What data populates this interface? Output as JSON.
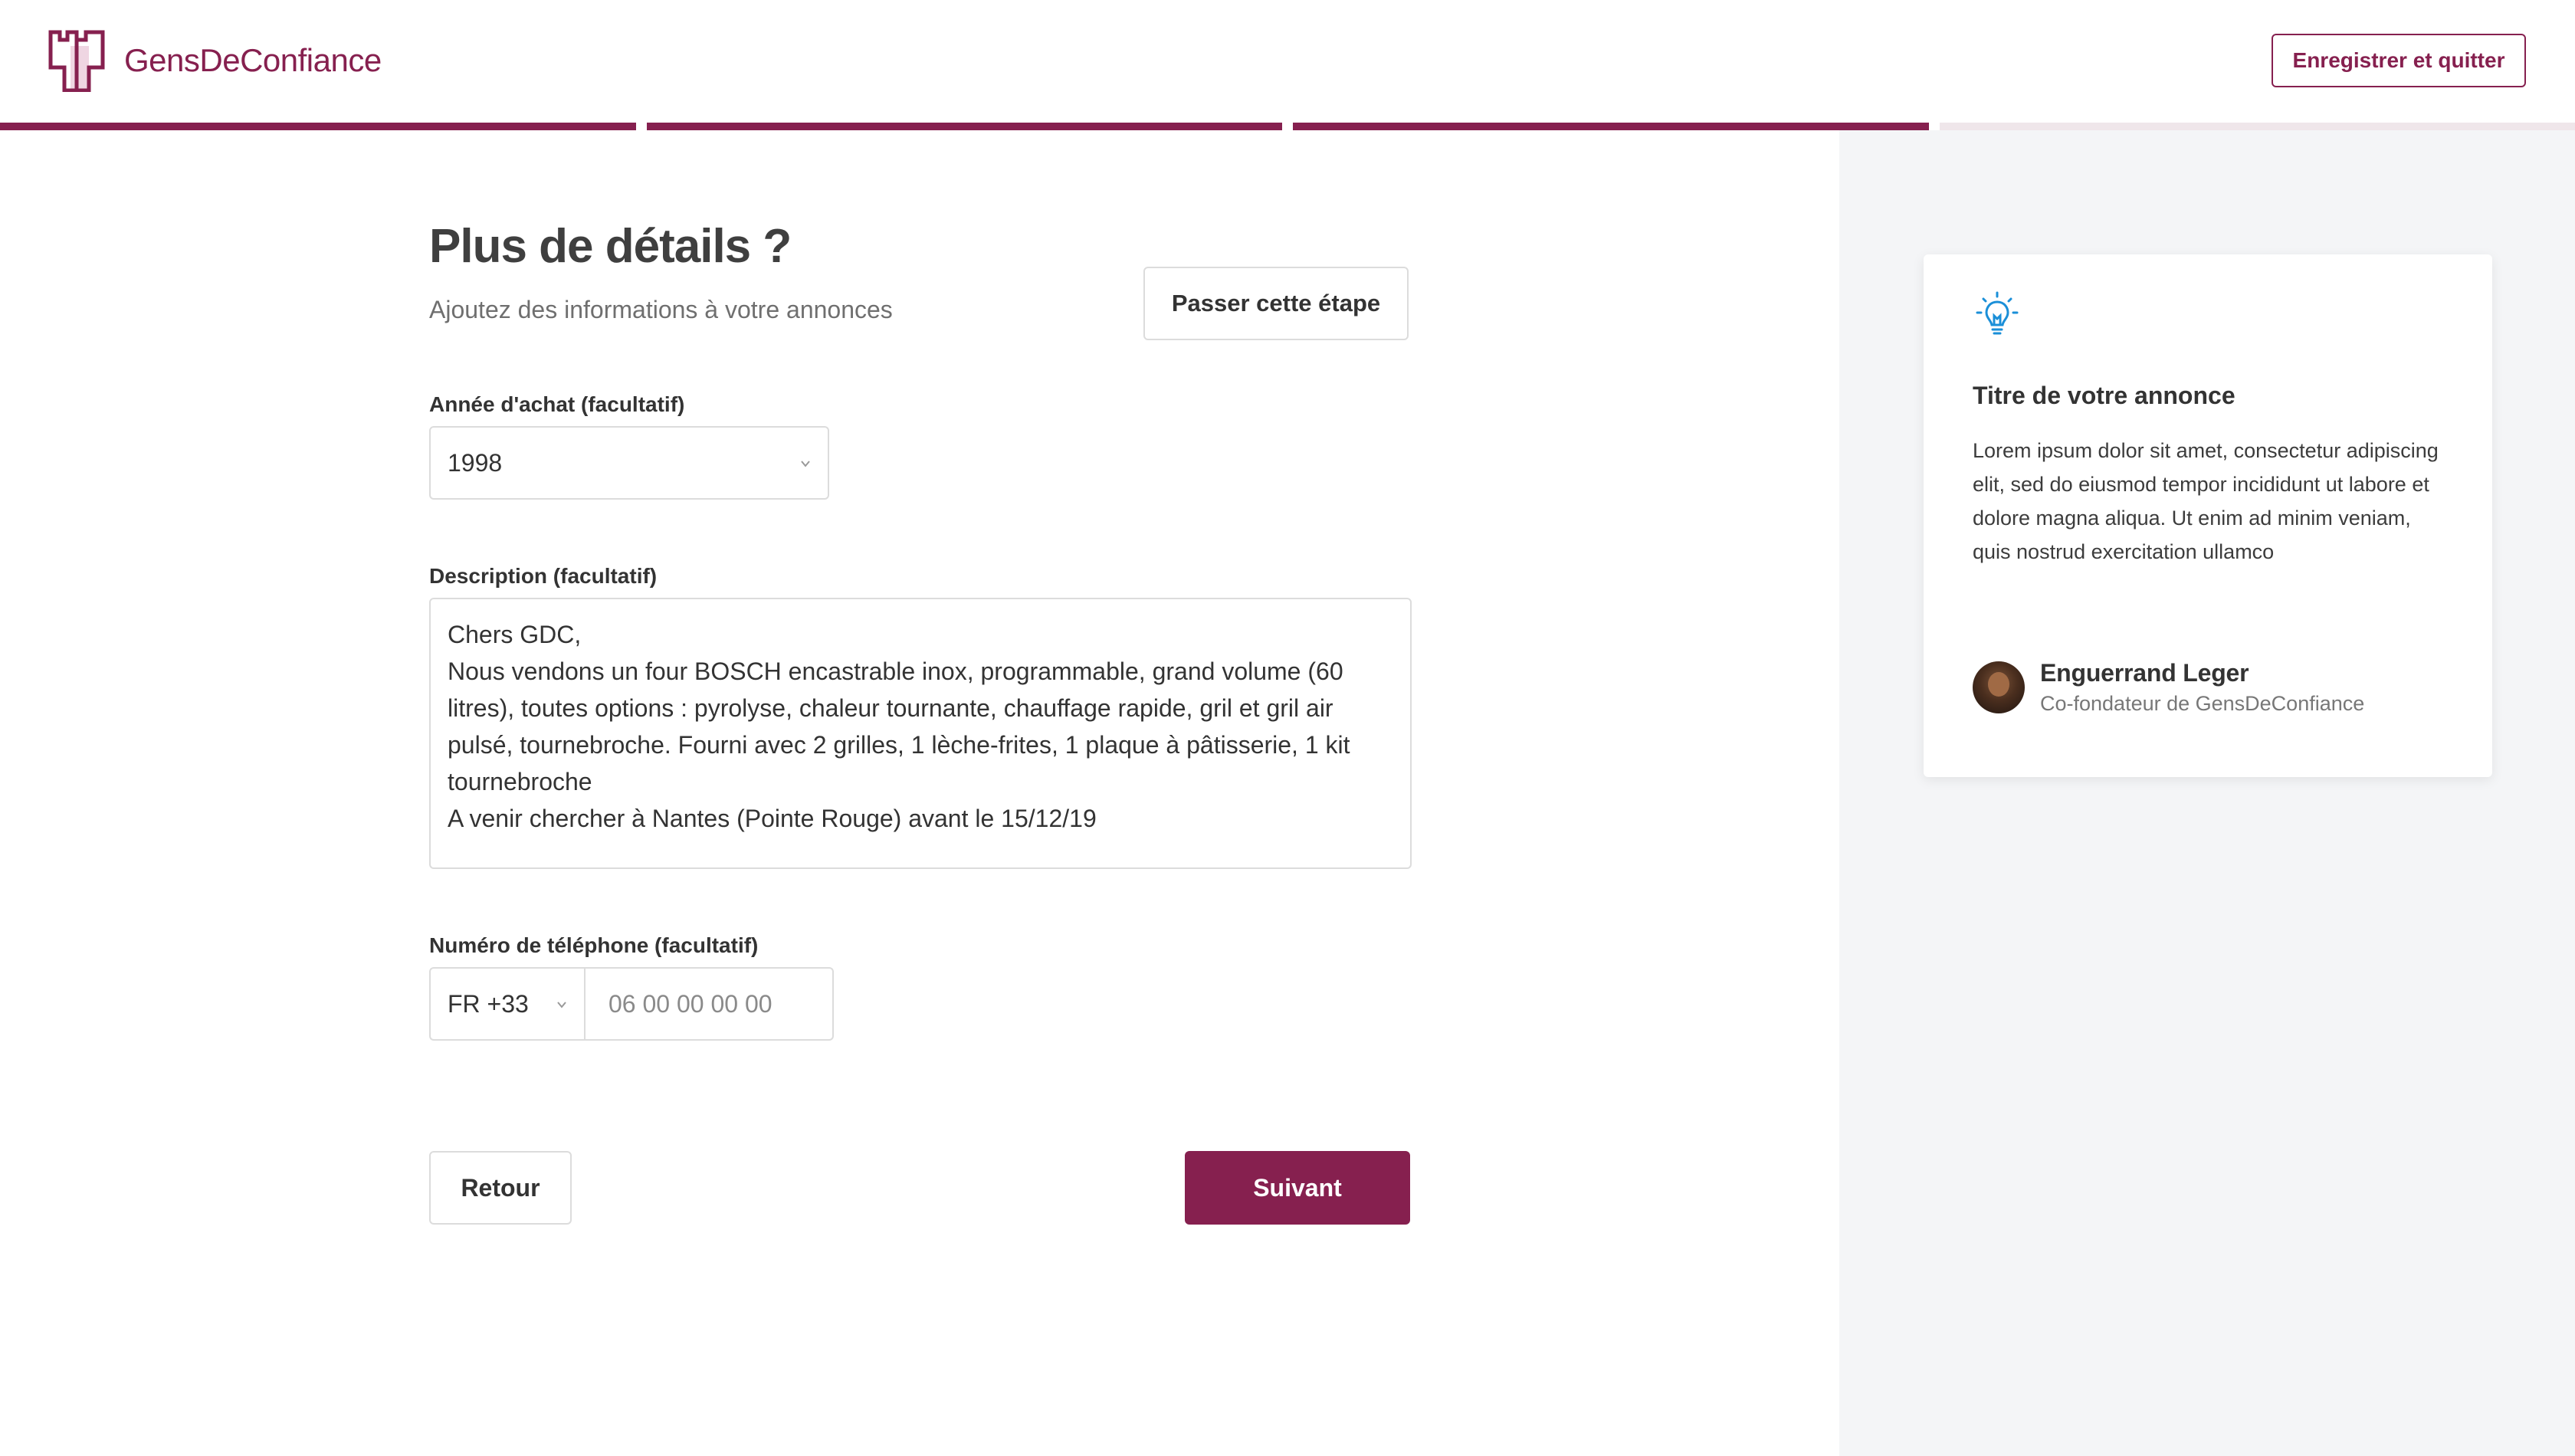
{
  "brand": {
    "name": "GensDeConfiance",
    "accent_color": "#86204f"
  },
  "header": {
    "save_quit_label": "Enregistrer et quitter"
  },
  "progress": {
    "steps_total": 4,
    "steps_completed": 3
  },
  "form": {
    "title": "Plus de détails ?",
    "subtitle": "Ajoutez des informations à votre annonces",
    "skip_label": "Passer cette étape",
    "year": {
      "label": "Année d'achat (facultatif)",
      "value": "1998"
    },
    "description": {
      "label": "Description (facultatif)",
      "value": "Chers GDC,\nNous vendons un four BOSCH encastrable inox, programmable, grand volume (60 litres), toutes options : pyrolyse, chaleur tournante, chauffage rapide, gril et gril air pulsé, tournebroche. Fourni avec 2 grilles, 1 lèche-frites, 1 plaque à pâtisserie, 1 kit tournebroche\nA venir chercher à Nantes (Pointe Rouge) avant le 15/12/19"
    },
    "phone": {
      "label": "Numéro de téléphone (facultatif)",
      "country_code": "FR +33",
      "placeholder": "06 00 00 00 00"
    },
    "back_label": "Retour",
    "next_label": "Suivant"
  },
  "tip": {
    "icon": "lightbulb-icon",
    "icon_color": "#1a8fd8",
    "title": "Titre de votre annonce",
    "text": "Lorem ipsum dolor sit amet, consectetur adipiscing elit, sed do eiusmod tempor incididunt ut labore et dolore magna aliqua. Ut enim ad minim veniam, quis nostrud exercitation ullamco",
    "author_name": "Enguerrand Leger",
    "author_role": "Co-fondateur de GensDeConfiance"
  }
}
